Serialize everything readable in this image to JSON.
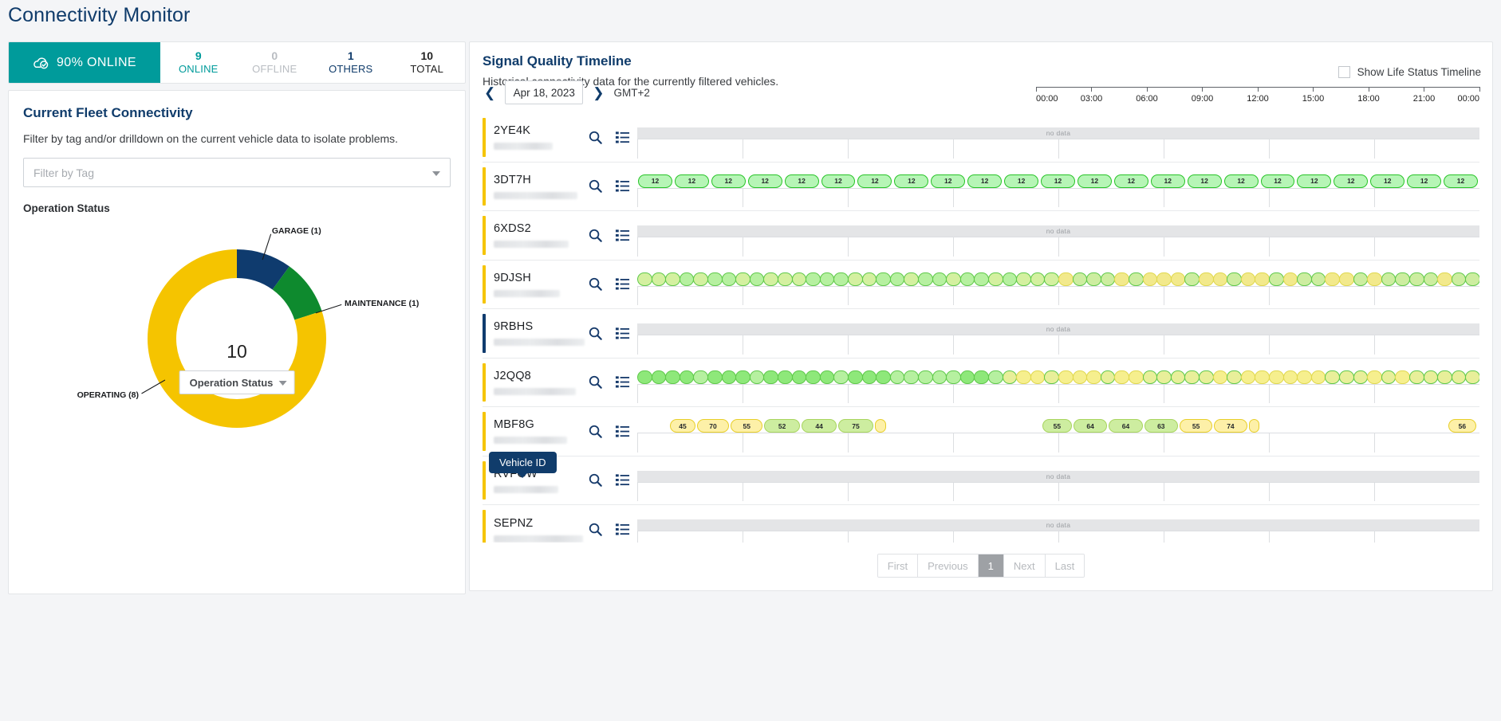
{
  "app": {
    "title": "Connectivity Monitor"
  },
  "status_bar": {
    "online_pill": {
      "label": "90% ONLINE",
      "icon": "cloud-check-icon",
      "color": "#009b9b"
    },
    "stats": [
      {
        "key": "online",
        "num": "9",
        "label": "ONLINE",
        "color": "#009b9b"
      },
      {
        "key": "offline",
        "num": "0",
        "label": "OFFLINE",
        "color": "#b9bdc2"
      },
      {
        "key": "others",
        "num": "1",
        "label": "OTHERS",
        "color": "#103c6b"
      },
      {
        "key": "total",
        "num": "10",
        "label": "TOTAL",
        "color": "#222222"
      }
    ]
  },
  "fleet_panel": {
    "title": "Current Fleet Connectivity",
    "subtitle": "Filter by tag and/or drilldown on the current vehicle data to isolate problems.",
    "tag_filter": {
      "placeholder": "Filter by Tag",
      "value": ""
    },
    "section_label": "Operation Status",
    "drilldown_select": {
      "value": "Operation Status"
    },
    "center_total": "10"
  },
  "chart_data": {
    "type": "pie",
    "title": "Operation Status",
    "center_label": "10",
    "legend_position": "callout-labels",
    "categories": [
      "OPERATING",
      "GARAGE",
      "MAINTENANCE"
    ],
    "values": [
      8,
      1,
      1
    ],
    "total": 10,
    "slices": [
      {
        "name": "GARAGE",
        "value": 1,
        "label": "GARAGE (1)",
        "color": "#0f3b6e"
      },
      {
        "name": "MAINTENANCE",
        "value": 1,
        "label": "MAINTENANCE (1)",
        "color": "#0e8a2e"
      },
      {
        "name": "OPERATING",
        "value": 8,
        "label": "OPERATING (8)",
        "color": "#f5c400"
      }
    ]
  },
  "timeline": {
    "title": "Signal Quality Timeline",
    "subtitle": "Historical connectivity data for the currently filtered vehicles.",
    "show_life_status": {
      "label": "Show Life Status Timeline",
      "checked": false
    },
    "date": "Apr 18, 2023",
    "timezone": "GMT+2",
    "prev_icon": "chevron-left-icon",
    "next_icon": "chevron-right-icon",
    "axis_ticks": [
      "00:00",
      "03:00",
      "06:00",
      "09:00",
      "12:00",
      "15:00",
      "18:00",
      "21:00",
      "00:00"
    ],
    "no_data_text": "no data",
    "tooltip": {
      "text": "Vehicle ID"
    },
    "row_icons": {
      "search": "magnifier-icon",
      "details": "list-details-icon"
    },
    "rows": [
      {
        "id": "2YE4K",
        "stripe": "#f5c400",
        "state": "no-data"
      },
      {
        "id": "3DT7H",
        "stripe": "#f5c400",
        "state": "pills",
        "pills": [
          {
            "v": "12",
            "c": "green"
          },
          {
            "v": "12",
            "c": "green"
          },
          {
            "v": "12",
            "c": "green"
          },
          {
            "v": "12",
            "c": "green"
          },
          {
            "v": "12",
            "c": "green"
          },
          {
            "v": "12",
            "c": "green"
          },
          {
            "v": "12",
            "c": "green"
          },
          {
            "v": "12",
            "c": "green"
          },
          {
            "v": "12",
            "c": "green"
          },
          {
            "v": "12",
            "c": "green"
          },
          {
            "v": "12",
            "c": "green"
          },
          {
            "v": "12",
            "c": "green"
          },
          {
            "v": "12",
            "c": "green"
          },
          {
            "v": "12",
            "c": "green"
          },
          {
            "v": "12",
            "c": "green"
          },
          {
            "v": "12",
            "c": "green"
          },
          {
            "v": "12",
            "c": "green"
          },
          {
            "v": "12",
            "c": "green"
          },
          {
            "v": "12",
            "c": "green"
          },
          {
            "v": "12",
            "c": "green"
          },
          {
            "v": "12",
            "c": "green"
          },
          {
            "v": "12",
            "c": "green"
          },
          {
            "v": "12",
            "c": "green"
          }
        ]
      },
      {
        "id": "6XDS2",
        "stripe": "#f5c400",
        "state": "no-data"
      },
      {
        "id": "9DJSH",
        "stripe": "#f5c400",
        "state": "dots",
        "dots_preset": "djsh"
      },
      {
        "id": "9RBHS",
        "stripe": "#0f3b6e",
        "state": "no-data"
      },
      {
        "id": "J2QQ8",
        "stripe": "#f5c400",
        "state": "dots",
        "dots_preset": "j2qq8"
      },
      {
        "id": "MBF8G",
        "stripe": "#f5c400",
        "state": "pills",
        "pills": [
          {
            "v": "45",
            "c": "yellow"
          },
          {
            "v": "70",
            "c": "yellow"
          },
          {
            "v": "55",
            "c": "yellow"
          },
          {
            "v": "52",
            "c": "lgreen"
          },
          {
            "v": "44",
            "c": "lgreen"
          },
          {
            "v": "75",
            "c": "lgreen"
          },
          {
            "v": "",
            "c": "yellow"
          },
          {
            "v": "55",
            "c": "lgreen"
          },
          {
            "v": "64",
            "c": "lgreen"
          },
          {
            "v": "64",
            "c": "lgreen"
          },
          {
            "v": "63",
            "c": "lgreen"
          },
          {
            "v": "55",
            "c": "yellow"
          },
          {
            "v": "74",
            "c": "yellow"
          },
          {
            "v": "",
            "c": "yellow"
          },
          {
            "v": "56",
            "c": "yellow"
          }
        ]
      },
      {
        "id": "RVFGW",
        "stripe": "#f5c400",
        "state": "no-data"
      },
      {
        "id": "SEPNZ",
        "stripe": "#f5c400",
        "state": "no-data"
      }
    ]
  },
  "pagination": {
    "first": "First",
    "previous": "Previous",
    "current": "1",
    "next": "Next",
    "last": "Last"
  }
}
